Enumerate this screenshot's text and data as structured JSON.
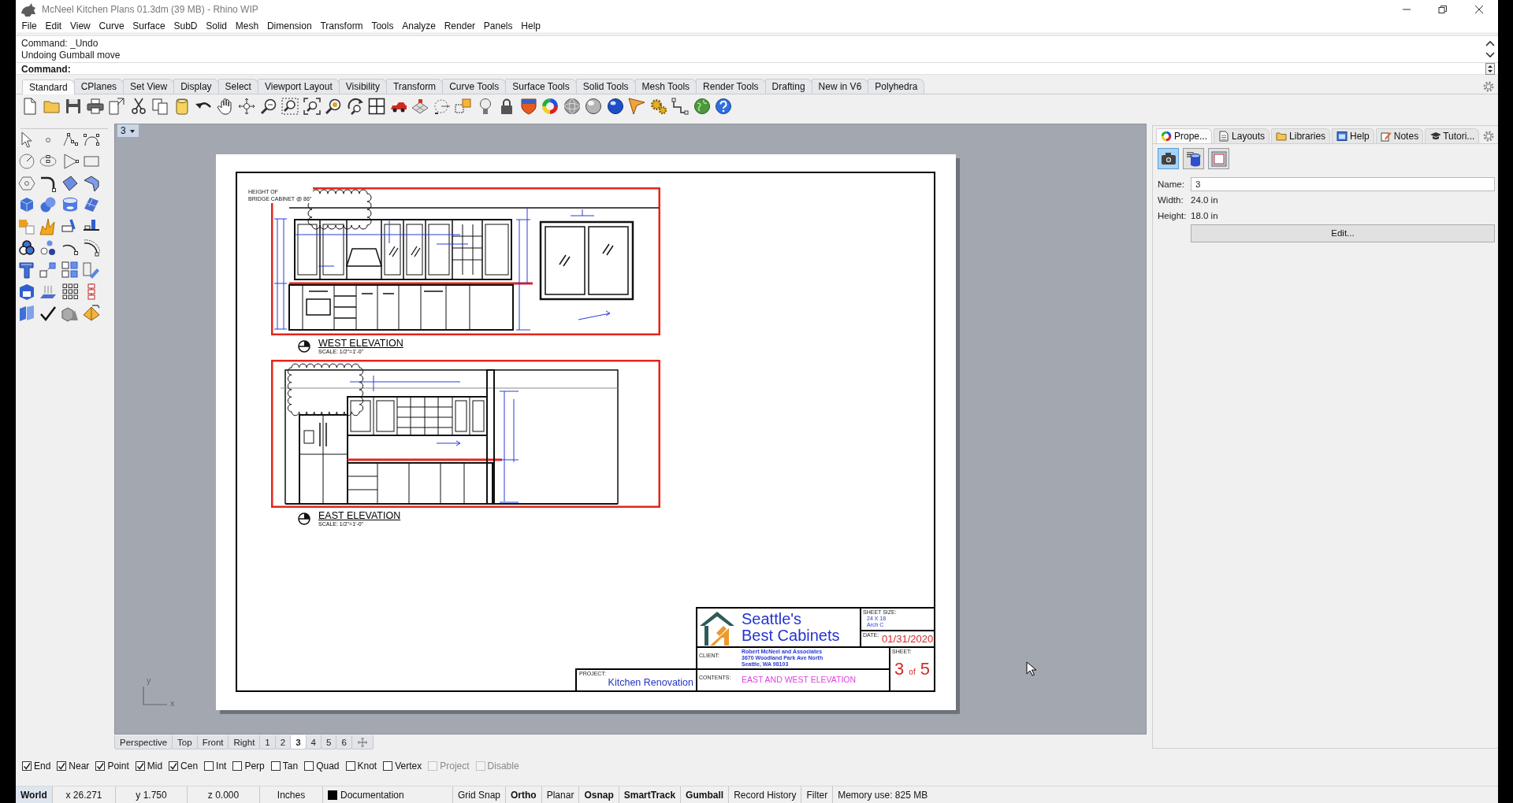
{
  "window": {
    "title": "McNeel Kitchen Plans 01.3dm (39 MB) - Rhino WIP"
  },
  "menu": [
    "File",
    "Edit",
    "View",
    "Curve",
    "Surface",
    "SubD",
    "Solid",
    "Mesh",
    "Dimension",
    "Transform",
    "Tools",
    "Analyze",
    "Render",
    "Panels",
    "Help"
  ],
  "command_history": [
    "Command: _Undo",
    "Undoing Gumball move"
  ],
  "command_prompt": "Command:",
  "toolbar_tabs": [
    {
      "label": "Standard",
      "selected": true
    },
    {
      "label": "CPlanes",
      "selected": false
    },
    {
      "label": "Set View",
      "selected": false
    },
    {
      "label": "Display",
      "selected": false
    },
    {
      "label": "Select",
      "selected": false
    },
    {
      "label": "Viewport Layout",
      "selected": false
    },
    {
      "label": "Visibility",
      "selected": false
    },
    {
      "label": "Transform",
      "selected": false
    },
    {
      "label": "Curve Tools",
      "selected": false
    },
    {
      "label": "Surface Tools",
      "selected": false
    },
    {
      "label": "Solid Tools",
      "selected": false
    },
    {
      "label": "Mesh Tools",
      "selected": false
    },
    {
      "label": "Render Tools",
      "selected": false
    },
    {
      "label": "Drafting",
      "selected": false
    },
    {
      "label": "New in V6",
      "selected": false
    },
    {
      "label": "Polyhedra",
      "selected": false
    }
  ],
  "viewport": {
    "title": "3",
    "sheet": {
      "note": [
        "HEIGHT OF",
        "BRIDGE CABINET @ 86\""
      ],
      "details": [
        {
          "kind": "range",
          "title": "WEST ELEVATION",
          "scale": "SCALE: 1/2\"=1'-0\""
        },
        {
          "kind": "fridge",
          "title": "EAST ELEVATION",
          "scale": "SCALE: 1/2\"=1'-0\""
        }
      ],
      "project": {
        "label": "PROJECT:",
        "value": "Kitchen Renovation"
      },
      "title_block": {
        "company": [
          "Seattle's",
          "Best Cabinets"
        ],
        "sheet_size": {
          "label": "SHEET SIZE:",
          "lines": [
            "24 X 18",
            "Arch C"
          ]
        },
        "date": {
          "label": "DATE:",
          "value": "01/31/2020"
        },
        "client": {
          "label": "CLIENT:",
          "lines": [
            "Robert McNeel and Associates",
            "3670 Woodland Park Ave North",
            "Seattle, WA 98103"
          ]
        },
        "sheet": {
          "label": "SHEET:",
          "current": "3",
          "joiner": "of",
          "total": "5"
        },
        "contents": {
          "label": "CONTENTS:",
          "value": "EAST AND WEST ELEVATION"
        }
      }
    },
    "axis_labels": [
      "y",
      "x"
    ]
  },
  "viewport_tabs": [
    {
      "label": "Perspective",
      "selected": false
    },
    {
      "label": "Top",
      "selected": false
    },
    {
      "label": "Front",
      "selected": false
    },
    {
      "label": "Right",
      "selected": false
    },
    {
      "label": "1",
      "selected": false
    },
    {
      "label": "2",
      "selected": false
    },
    {
      "label": "3",
      "selected": true
    },
    {
      "label": "4",
      "selected": false
    },
    {
      "label": "5",
      "selected": false
    },
    {
      "label": "6",
      "selected": false
    }
  ],
  "panel": {
    "tabs": [
      {
        "kind": "properties",
        "label": "Prope...",
        "selected": true
      },
      {
        "kind": "layouts",
        "label": "Layouts",
        "selected": false
      },
      {
        "kind": "libraries",
        "label": "Libraries",
        "selected": false
      },
      {
        "kind": "help",
        "label": "Help",
        "selected": false
      },
      {
        "kind": "notes",
        "label": "Notes",
        "selected": false
      },
      {
        "kind": "tutorials",
        "label": "Tutori...",
        "selected": false
      }
    ],
    "view_buttons": [
      {
        "kind": "camera",
        "selected": true
      },
      {
        "kind": "database",
        "selected": false
      },
      {
        "kind": "frame",
        "selected": false
      }
    ],
    "name": {
      "label": "Name:",
      "value": "3"
    },
    "width": {
      "label": "Width:",
      "value": "24.0 in"
    },
    "height": {
      "label": "Height:",
      "value": "18.0 in"
    },
    "edit_button": "Edit..."
  },
  "osnaps": [
    {
      "label": "End",
      "checked": true,
      "disabled": false
    },
    {
      "label": "Near",
      "checked": true,
      "disabled": false
    },
    {
      "label": "Point",
      "checked": true,
      "disabled": false
    },
    {
      "label": "Mid",
      "checked": true,
      "disabled": false
    },
    {
      "label": "Cen",
      "checked": true,
      "disabled": false
    },
    {
      "label": "Int",
      "checked": false,
      "disabled": false
    },
    {
      "label": "Perp",
      "checked": false,
      "disabled": false
    },
    {
      "label": "Tan",
      "checked": false,
      "disabled": false
    },
    {
      "label": "Quad",
      "checked": false,
      "disabled": false
    },
    {
      "label": "Knot",
      "checked": false,
      "disabled": false
    },
    {
      "label": "Vertex",
      "checked": false,
      "disabled": false
    },
    {
      "label": "Project",
      "checked": false,
      "disabled": true
    },
    {
      "label": "Disable",
      "checked": false,
      "disabled": true
    }
  ],
  "status_bar": {
    "cplane": "World",
    "x": "x 26.271",
    "y": "y 1.750",
    "z": "z 0.000",
    "units": "Inches",
    "layer": {
      "name": "Documentation",
      "color": "#000000"
    },
    "toggles": [
      {
        "label": "Grid Snap",
        "on": false
      },
      {
        "label": "Ortho",
        "on": true
      },
      {
        "label": "Planar",
        "on": false
      },
      {
        "label": "Osnap",
        "on": true
      },
      {
        "label": "SmartTrack",
        "on": true
      },
      {
        "label": "Gumball",
        "on": true
      },
      {
        "label": "Record History",
        "on": false
      },
      {
        "label": "Filter",
        "on": false
      }
    ],
    "memory": "Memory use: 825 MB"
  }
}
